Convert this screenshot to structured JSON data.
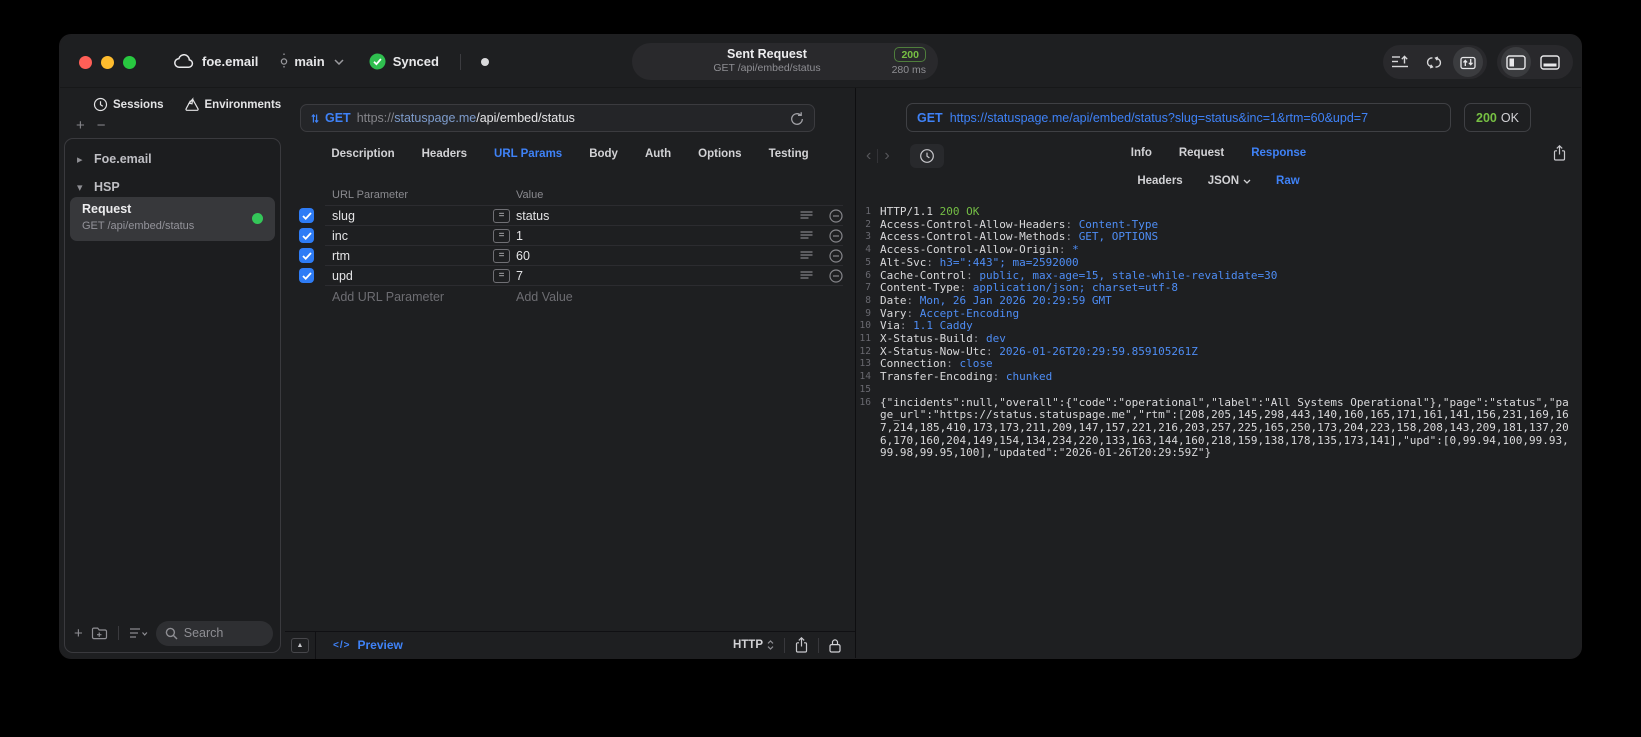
{
  "colors": {
    "accent_blue": "#3f82f7",
    "status_green": "#77c043",
    "checkbox_blue": "#2e7cf6",
    "request_dot_green": "#34c759",
    "traffic_red": "#ff5f57",
    "traffic_yellow": "#febc2e",
    "traffic_green": "#28c840"
  },
  "titlebar": {
    "project": "foe.email",
    "branch": "main",
    "sync": "Synced",
    "request_title": "Sent Request",
    "request_subtitle": "GET /api/embed/status",
    "status_code": "200",
    "latency": "280 ms"
  },
  "sidebar": {
    "tabs": [
      {
        "label": "Sessions"
      },
      {
        "label": "Environments"
      }
    ],
    "tree": [
      {
        "label": "Foe.email",
        "state": "collapsed"
      },
      {
        "label": "HSP",
        "state": "expanded"
      }
    ],
    "request": {
      "title": "Request",
      "subtitle": "GET /api/embed/status"
    },
    "search_placeholder": "Search"
  },
  "request_editor": {
    "method": "GET",
    "url": {
      "scheme": "https://",
      "host": "statuspage.me",
      "path": "/api/embed/status"
    },
    "tabs": [
      "Description",
      "Headers",
      "URL Params",
      "Body",
      "Auth",
      "Options",
      "Testing"
    ],
    "active_tab": "URL Params",
    "params": {
      "columns": [
        "URL Parameter",
        "Value"
      ],
      "rows": [
        {
          "checked": true,
          "name": "slug",
          "value": "status"
        },
        {
          "checked": true,
          "name": "inc",
          "value": "1"
        },
        {
          "checked": true,
          "name": "rtm",
          "value": "60"
        },
        {
          "checked": true,
          "name": "upd",
          "value": "7"
        }
      ],
      "add_name_placeholder": "Add URL Parameter",
      "add_value_placeholder": "Add Value"
    },
    "footer": {
      "code_glyph": "</>",
      "preview": "Preview",
      "protocol": "HTTP"
    }
  },
  "response_viewer": {
    "method": "GET",
    "url": "https://statuspage.me/api/embed/status?slug=status&inc=1&rtm=60&upd=7",
    "status_code": "200",
    "status_text": "OK",
    "tabs": [
      "Info",
      "Request",
      "Response"
    ],
    "active_tab": "Response",
    "view_tabs": [
      "Headers",
      "JSON",
      "Raw"
    ],
    "active_view": "Raw",
    "body_lines": [
      {
        "n": 1,
        "s": [
          {
            "t": "HTTP/1.1 ",
            "c": "w"
          },
          {
            "t": "200 OK",
            "c": "g"
          }
        ]
      },
      {
        "n": 2,
        "s": [
          {
            "t": "Access-Control-Allow-Headers",
            "c": "w"
          },
          {
            "t": ": ",
            "c": "d"
          },
          {
            "t": "Content-Type",
            "c": "b"
          }
        ]
      },
      {
        "n": 3,
        "s": [
          {
            "t": "Access-Control-Allow-Methods",
            "c": "w"
          },
          {
            "t": ": ",
            "c": "d"
          },
          {
            "t": "GET, OPTIONS",
            "c": "b"
          }
        ]
      },
      {
        "n": 4,
        "s": [
          {
            "t": "Access-Control-Allow-Origin",
            "c": "w"
          },
          {
            "t": ": ",
            "c": "d"
          },
          {
            "t": "*",
            "c": "b"
          }
        ]
      },
      {
        "n": 5,
        "s": [
          {
            "t": "Alt-Svc",
            "c": "w"
          },
          {
            "t": ": ",
            "c": "d"
          },
          {
            "t": "h3=\":443\"; ma=2592000",
            "c": "b"
          }
        ]
      },
      {
        "n": 6,
        "s": [
          {
            "t": "Cache-Control",
            "c": "w"
          },
          {
            "t": ": ",
            "c": "d"
          },
          {
            "t": "public, max-age=15, stale-while-revalidate=30",
            "c": "b"
          }
        ]
      },
      {
        "n": 7,
        "s": [
          {
            "t": "Content-Type",
            "c": "w"
          },
          {
            "t": ": ",
            "c": "d"
          },
          {
            "t": "application/json; charset=utf-8",
            "c": "b"
          }
        ]
      },
      {
        "n": 8,
        "s": [
          {
            "t": "Date",
            "c": "w"
          },
          {
            "t": ": ",
            "c": "d"
          },
          {
            "t": "Mon, 26 Jan 2026 20:29:59 GMT",
            "c": "b"
          }
        ]
      },
      {
        "n": 9,
        "s": [
          {
            "t": "Vary",
            "c": "w"
          },
          {
            "t": ": ",
            "c": "d"
          },
          {
            "t": "Accept-Encoding",
            "c": "b"
          }
        ]
      },
      {
        "n": 10,
        "s": [
          {
            "t": "Via",
            "c": "w"
          },
          {
            "t": ": ",
            "c": "d"
          },
          {
            "t": "1.1 Caddy",
            "c": "b"
          }
        ]
      },
      {
        "n": 11,
        "s": [
          {
            "t": "X-Status-Build",
            "c": "w"
          },
          {
            "t": ": ",
            "c": "d"
          },
          {
            "t": "dev",
            "c": "b"
          }
        ]
      },
      {
        "n": 12,
        "s": [
          {
            "t": "X-Status-Now-Utc",
            "c": "w"
          },
          {
            "t": ": ",
            "c": "d"
          },
          {
            "t": "2026-01-26T20:29:59.859105261Z",
            "c": "b"
          }
        ]
      },
      {
        "n": 13,
        "s": [
          {
            "t": "Connection",
            "c": "w"
          },
          {
            "t": ": ",
            "c": "d"
          },
          {
            "t": "close",
            "c": "b"
          }
        ]
      },
      {
        "n": 14,
        "s": [
          {
            "t": "Transfer-Encoding",
            "c": "w"
          },
          {
            "t": ": ",
            "c": "d"
          },
          {
            "t": "chunked",
            "c": "b"
          }
        ]
      },
      {
        "n": 15,
        "s": []
      },
      {
        "n": 16,
        "s": [
          {
            "t": "{\"incidents\":null,\"overall\":{\"code\":\"operational\",\"label\":\"All Systems Operational\"},\"page\":\"status\",\"page_url\":\"https://status.statuspage.me\",\"rtm\":[208,205,145,298,443,140,160,165,171,161,141,156,231,169,167,214,185,410,173,173,211,209,147,157,221,216,203,257,225,165,250,173,204,223,158,208,143,209,181,137,206,170,160,204,149,154,134,234,220,133,163,144,160,218,159,138,178,135,173,141],\"upd\":[0,99.94,100,99.93,99.98,99.95,100],\"updated\":\"2026-01-26T20:29:59Z\"}",
            "c": "w"
          }
        ]
      }
    ]
  }
}
